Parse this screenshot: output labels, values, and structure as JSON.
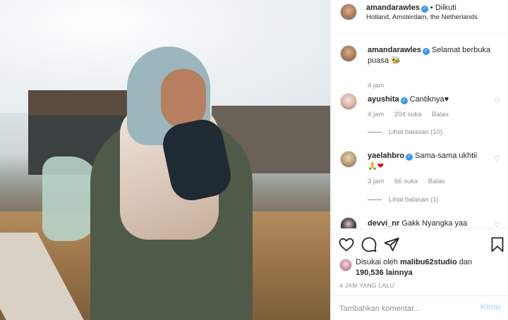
{
  "post": {
    "username": "amandarawles",
    "follow_status": "Diikuti",
    "location": "Holland, Amsterdam, the Netherlands"
  },
  "comments": [
    {
      "username": "amandarawles",
      "text": "Selamat berbuka puasa",
      "emoji": "🐝",
      "time": "4 jam"
    },
    {
      "username": "ayushita",
      "text": "Cantiknya♥",
      "time": "4 jam",
      "likes": "204 suka",
      "reply": "Balas",
      "view_replies": "Lihat balasan (10)"
    },
    {
      "username": "yaelahbro",
      "text": "Sama-sama ukhtii",
      "emoji": "🙏❤",
      "time": "3 jam",
      "likes": "66 suka",
      "reply": "Balas",
      "view_replies": "Lihat balasan (1)"
    },
    {
      "username": "devvi_nr",
      "text": "Gakk Nyangka yaa"
    }
  ],
  "likes": {
    "prefix": "Disukai oleh",
    "liked_by": "malibu62studio",
    "conj": "dan",
    "count": "190,536",
    "suffix": "lainnya"
  },
  "timestamp": "4 JAM YANG LALU",
  "add_comment": {
    "placeholder": "Tambahkan komentar...",
    "post_label": "Kirim"
  },
  "colors": {
    "verified": "#3897f0",
    "muted": "#8e8e8e",
    "post_disabled": "#b2dffc"
  }
}
